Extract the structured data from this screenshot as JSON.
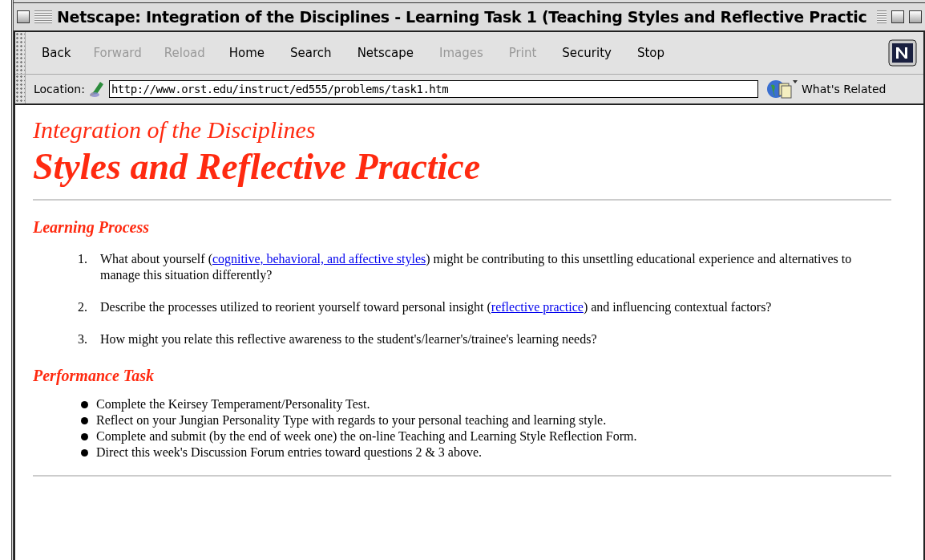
{
  "window": {
    "title": "Netscape: Integration of the Disciplines - Learning Task 1 (Teaching Styles and Reflective Practic"
  },
  "toolbar": {
    "buttons": [
      {
        "label": "Back",
        "disabled": false
      },
      {
        "label": "Forward",
        "disabled": true
      },
      {
        "label": "Reload",
        "disabled": true
      },
      {
        "label": "Home",
        "disabled": false
      },
      {
        "label": "Search",
        "disabled": false
      },
      {
        "label": "Netscape",
        "disabled": false
      },
      {
        "label": "Images",
        "disabled": true
      },
      {
        "label": "Print",
        "disabled": true
      },
      {
        "label": "Security",
        "disabled": false
      },
      {
        "label": "Stop",
        "disabled": false
      }
    ]
  },
  "location_bar": {
    "label": "Location:",
    "url": "http://www.orst.edu/instruct/ed555/problems/task1.htm",
    "related": "What's Related"
  },
  "page": {
    "subtitle": "Integration of the Disciplines",
    "title": "Styles and Reflective Practice",
    "sections": [
      {
        "heading": "Learning Process",
        "kind": "numbered",
        "items": [
          {
            "number": "1.",
            "parts": [
              {
                "text": "What about yourself ("
              },
              {
                "text": "cognitive, behavioral, and affective styles",
                "link": true
              },
              {
                "text": ") might be contributing to this unsettling educational experience and alternatives to manage this situation differently?"
              }
            ]
          },
          {
            "number": "2.",
            "parts": [
              {
                "text": "Describe the processes utilized to reorient yourself toward personal insight ("
              },
              {
                "text": "reflective practice",
                "link": true
              },
              {
                "text": ") and influencing contextual factors?"
              }
            ]
          },
          {
            "number": "3.",
            "parts": [
              {
                "text": "How might you relate this reflective awareness to the student's/learner's/trainee's learning needs?"
              }
            ]
          }
        ]
      },
      {
        "heading": "Performance Task",
        "kind": "bulleted",
        "items": [
          {
            "parts": [
              {
                "text": "Complete the Keirsey Temperament/Personality Test."
              }
            ]
          },
          {
            "parts": [
              {
                "text": "Reflect on your Jungian Personality Type with regards to your personal teaching and learning style."
              }
            ]
          },
          {
            "parts": [
              {
                "text": "Complete and submit (by the end of week one) the on-line Teaching and Learning Style Reflection Form."
              }
            ]
          },
          {
            "parts": [
              {
                "text": "Direct this week's Discussion Forum entries toward questions 2 & 3 above."
              }
            ]
          }
        ]
      }
    ]
  }
}
